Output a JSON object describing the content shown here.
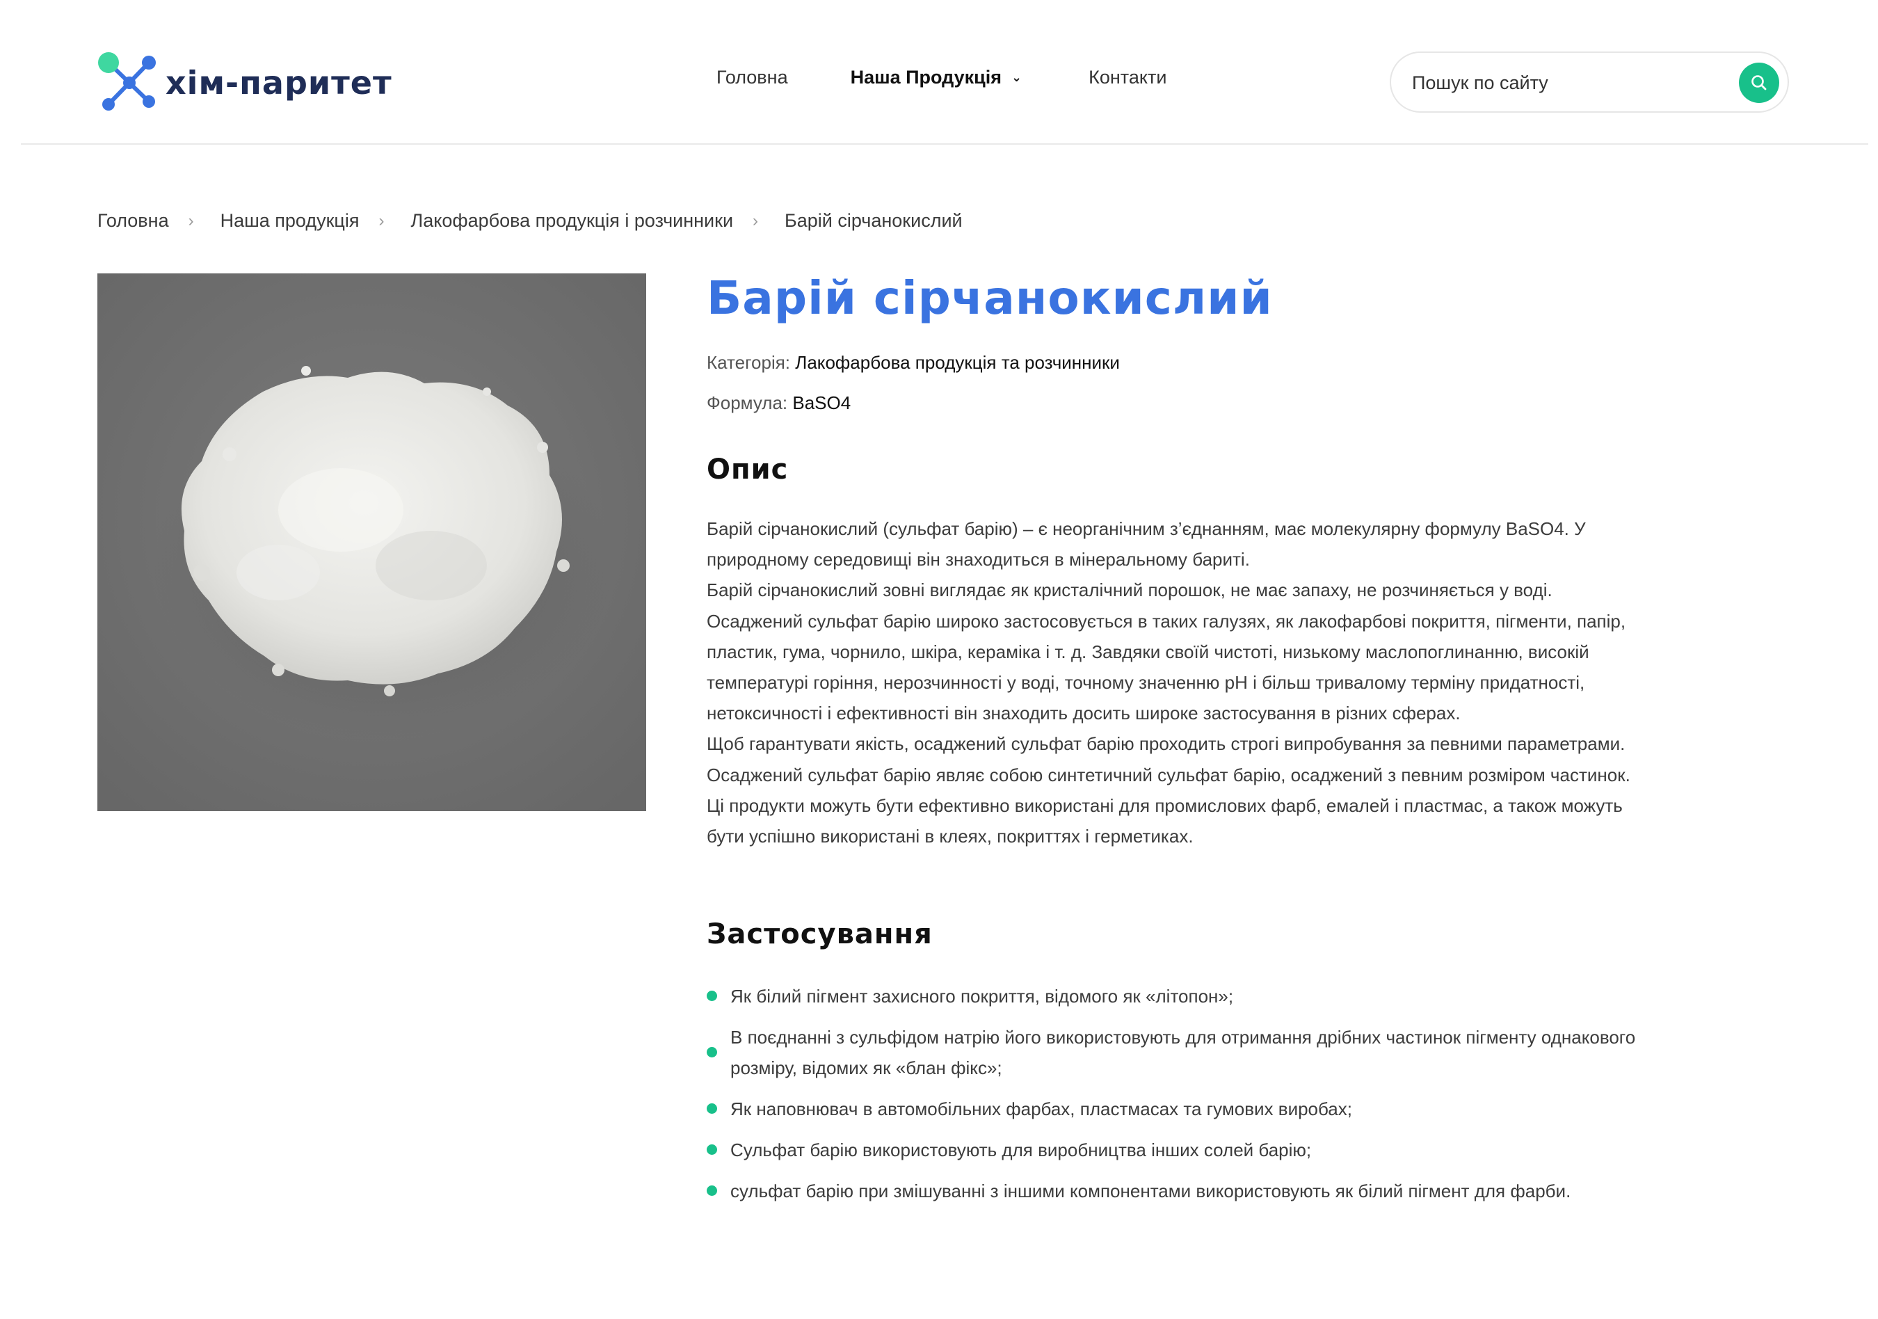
{
  "brand": {
    "name": "хім-паритет",
    "colors": {
      "blue": "#3a73e0",
      "green": "#18c08a",
      "dark": "#1f2d57"
    }
  },
  "nav": {
    "home": "Головна",
    "products": "Наша Продукція",
    "contacts": "Контакти"
  },
  "search": {
    "placeholder": "Пошук по сайту",
    "icon": "search-icon"
  },
  "breadcrumb": [
    "Головна",
    "Наша продукція",
    "Лакофарбова продукція і розчинники",
    "Барій сірчанокислий"
  ],
  "product": {
    "title": "Барій сірчанокислий",
    "category_label": "Категорія:",
    "category_value": "Лакофарбова продукція та розчинники",
    "formula_label": "Формула:",
    "formula_value": "BaSO4",
    "image": "white-powder-photo"
  },
  "description": {
    "heading": "Опис",
    "paragraphs": [
      "Барій сірчанокислий (сульфат барію) – є неорганічним з’єднанням, має молекулярну формулу BaSO4. У природному середовищі він знаходиться в мінеральному бариті.",
      "Барій сірчанокислий зовні виглядає як кристалічний порошок, не має запаху, не розчиняється у воді.",
      "Осаджений сульфат барію широко застосовується в таких галузях, як лакофарбові покриття, пігменти, папір, пластик, гума, чорнило, шкіра, кераміка і т. д. Завдяки своїй чистоті, низькому маслопоглинанню, високій температурі горіння, нерозчинності у воді, точному значенню pH і більш тривалому терміну придатності, нетоксичності і ефективності він знаходить досить широке застосування в різних сферах.",
      "Щоб гарантувати якість, осаджений сульфат барію проходить строгі випробування за певними параметрами.",
      "Осаджений сульфат барію являє собою синтетичний сульфат барію, осаджений з певним розміром частинок. Ці продукти можуть бути ефективно використані для промислових фарб, емалей і пластмас, а також можуть бути успішно використані в клеях, покриттях і герметиках."
    ]
  },
  "applications": {
    "heading": "Застосування",
    "items": [
      "Як білий пігмент захисного покриття, відомого як «літопон»;",
      "В поєднанні з сульфідом натрію його використовують для отримання дрібних частинок пігменту однакового розміру, відомих як «блан фікс»;",
      "Як наповнювач в автомобільних фарбах, пластмасах та гумових виробах;",
      "Сульфат барію використовують для виробництва інших солей барію;",
      "сульфат барію при змішуванні з іншими компонентами використовують як білий пігмент для фарби."
    ]
  }
}
